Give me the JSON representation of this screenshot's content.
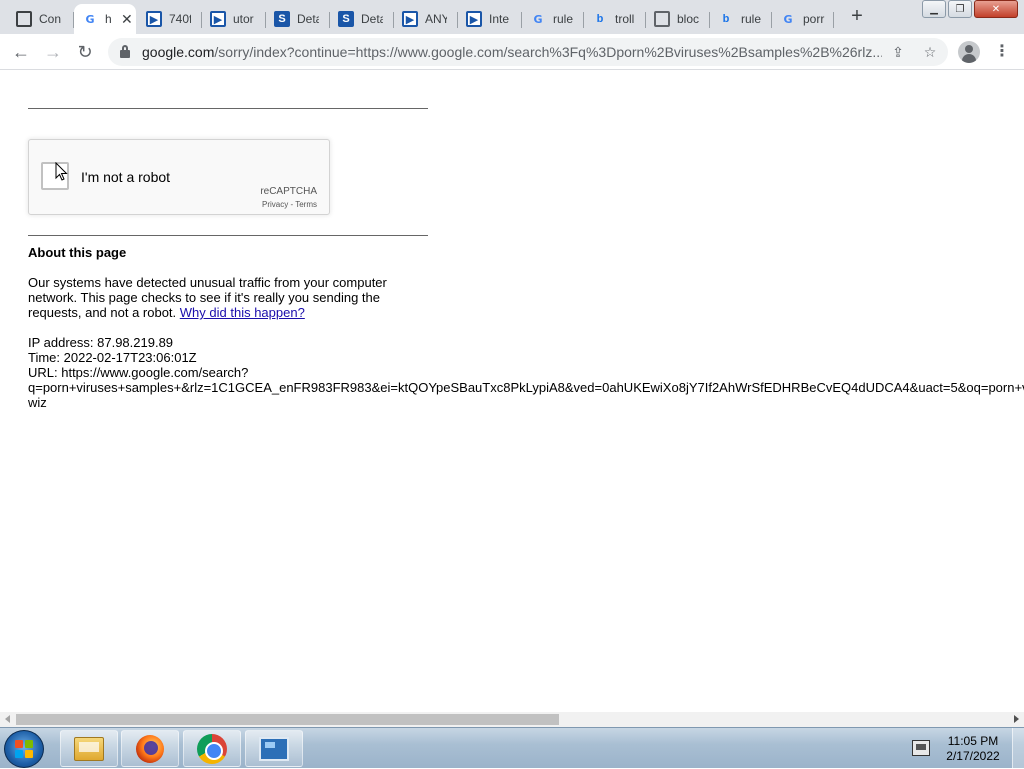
{
  "browser": {
    "tabs": [
      {
        "title": "Con",
        "icon": "github-icon"
      },
      {
        "title": "h",
        "icon": "google-icon",
        "active": true
      },
      {
        "title": "740f",
        "icon": "anyrun-icon"
      },
      {
        "title": "utor",
        "icon": "anyrun-icon"
      },
      {
        "title": "Deta",
        "icon": "s-icon"
      },
      {
        "title": "Deta",
        "icon": "s-icon"
      },
      {
        "title": "ANY",
        "icon": "anyrun-icon"
      },
      {
        "title": "Inte",
        "icon": "anyrun-icon"
      },
      {
        "title": "rule",
        "icon": "google-icon"
      },
      {
        "title": "troll",
        "icon": "bing-icon"
      },
      {
        "title": "bloc",
        "icon": "globe-icon"
      },
      {
        "title": "rule",
        "icon": "bing-icon"
      },
      {
        "title": "porr",
        "icon": "google-icon"
      }
    ],
    "new_tab": "+",
    "url_host": "google.com",
    "url_rest": "/sorry/index?continue=https://www.google.com/search%3Fq%3Dporn%2Bviruses%2Bsamples%2B%26rlz..."
  },
  "page": {
    "recaptcha": {
      "label": "I'm not a robot",
      "brand": "reCAPTCHA",
      "links": "Privacy - Terms"
    },
    "about_title": "About this page",
    "paragraph": "Our systems have detected unusual traffic from your computer network. This page checks to see if it's really you sending the requests, and not a robot.",
    "why_link": "Why did this happen?",
    "ip_line": "IP address: 87.98.219.89",
    "time_line": "Time: 2022-02-17T23:06:01Z",
    "url_line1": "URL: https://www.google.com/search?",
    "url_line2": "q=porn+viruses+samples+&rlz=1C1GCEA_enFR983FR983&ei=ktQOYpeSBauTxc8PkLypiA8&ved=0ahUKEwiXo8jY7If2AhWrSfEDHRBeCvEQ4dUDCA4&uact=5&oq=porn+v",
    "url_line3": "wiz"
  },
  "taskbar": {
    "time": "11:05 PM",
    "date": "2/17/2022"
  },
  "colors": {
    "link": "#1a0dab",
    "tab_strip": "#dee1e6"
  }
}
